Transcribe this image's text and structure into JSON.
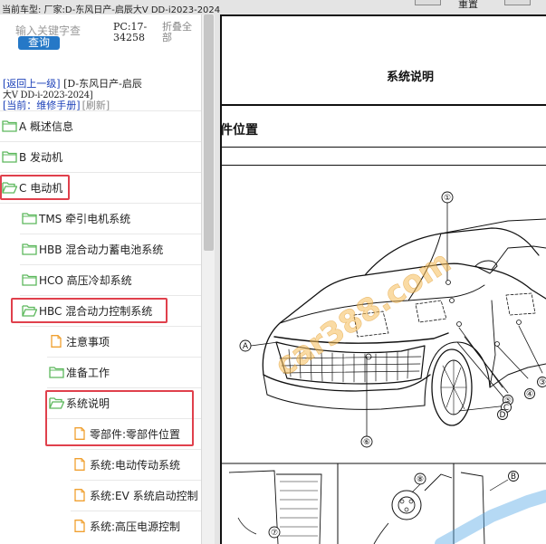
{
  "topbar": {
    "car_model": "当前车型:  厂家:D-东风日产-启辰大V DD-i2023-2024",
    "mid_button": "重置"
  },
  "search": {
    "placeholder": "输入关键字查",
    "button": "查询"
  },
  "pc_code": "PC:17-34258",
  "collapse_all": "折叠全部",
  "nav": {
    "up_link": "[返回上一级]",
    "path_part1": "[D-东风日产-启辰",
    "path_part2": "大V DD-i-2023-2024]",
    "current_label": "[当前：维修手册]",
    "refresh": "[刷新]"
  },
  "tree": [
    {
      "label": "A 概述信息",
      "type": "folder-closed"
    },
    {
      "label": "B 发动机",
      "type": "folder-closed"
    },
    {
      "label": "C 电动机",
      "type": "folder-open"
    },
    {
      "label": "TMS 牵引电机系统",
      "type": "folder-closed"
    },
    {
      "label": "HBB 混合动力蓄电池系统",
      "type": "folder-closed"
    },
    {
      "label": "HCO 高压冷却系统",
      "type": "folder-closed"
    },
    {
      "label": "HBC 混合动力控制系统",
      "type": "folder-open"
    },
    {
      "label": "注意事项",
      "type": "page"
    },
    {
      "label": "准备工作",
      "type": "folder-closed"
    },
    {
      "label": "系统说明",
      "type": "folder-open"
    },
    {
      "label": "零部件:零部件位置",
      "type": "page"
    },
    {
      "label": "系统:电动传动系统",
      "type": "page"
    },
    {
      "label": "系统:EV 系统启动控制",
      "type": "page"
    },
    {
      "label": "系统:高压电源控制",
      "type": "page"
    }
  ],
  "document": {
    "title": "系统说明",
    "section": "件位置",
    "callouts": [
      "①",
      "②",
      "③",
      "④",
      "⑤",
      "⑥",
      "⑦",
      "⑧",
      "A",
      "B",
      "C",
      "D"
    ],
    "watermark": "car388.com"
  },
  "colors": {
    "accent_blue": "#2578c7",
    "highlight_red": "#e0404c",
    "folder_green": "#5cb85c",
    "page_orange": "#f0a030"
  }
}
